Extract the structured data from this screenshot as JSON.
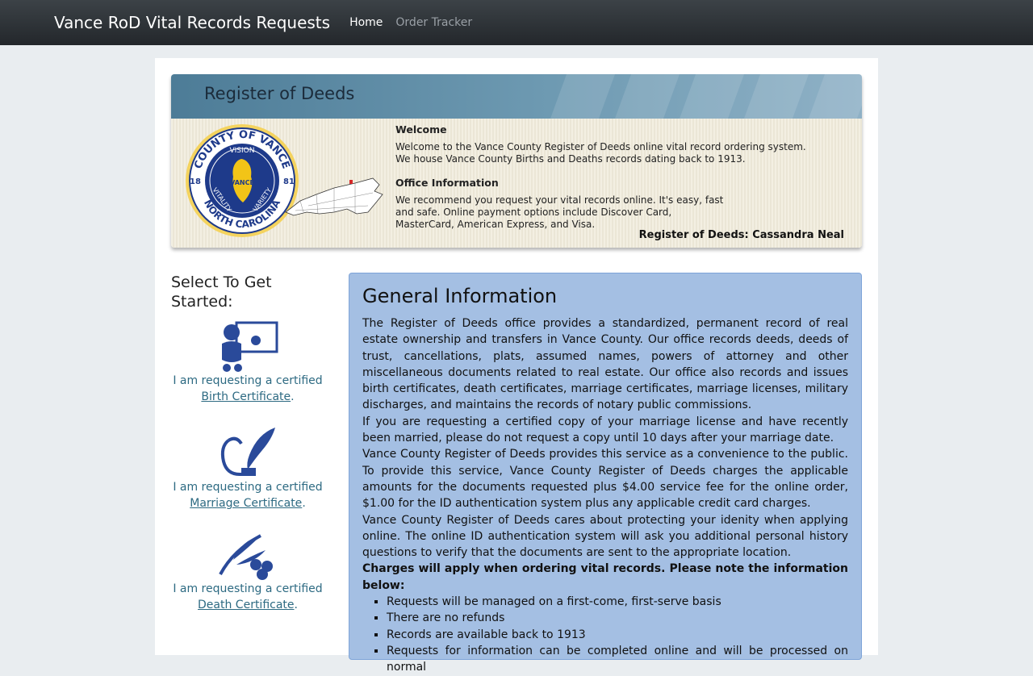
{
  "navbar": {
    "brand": "Vance RoD Vital Records Requests",
    "links": [
      {
        "label": "Home",
        "active": true
      },
      {
        "label": "Order Tracker",
        "active": false
      }
    ]
  },
  "banner": {
    "title": "Register of Deeds",
    "welcome_heading": "Welcome",
    "welcome_text_1": "Welcome to the Vance County Register of Deeds online vital record ordering system.",
    "welcome_text_2": "We house Vance County Births and Deaths records dating back to 1913.",
    "office_heading": "Office Information",
    "office_text": "We recommend you request your vital records online.  It's easy, fast and safe.  Online payment options include Discover Card, MasterCard, American Express, and Visa.",
    "register_name": "Register of Deeds: Cassandra Neal",
    "seal": {
      "top_text": "COUNTY OF VANCE",
      "bottom_text": "NORTH CAROLINA",
      "vision": "VISION",
      "vitality": "VITALITY",
      "variety": "VARIETY",
      "center": "VANCE",
      "year_left": "18",
      "year_right": "81"
    }
  },
  "sidebar": {
    "heading": "Select To Get Started:",
    "options": [
      {
        "icon": "baby-certificate-icon",
        "prefix": "I am requesting a certified",
        "link": "Birth Certificate",
        "suffix": "."
      },
      {
        "icon": "quill-scroll-icon",
        "prefix": "I am requesting a certified",
        "link": "Marriage Certificate",
        "suffix": "."
      },
      {
        "icon": "olive-branch-icon",
        "prefix": "I am requesting a certified",
        "link": "Death Certificate",
        "suffix": "."
      }
    ]
  },
  "info": {
    "title": "General Information",
    "p1": "The Register of Deeds office provides a standardized, permanent record of real estate ownership and transfers in Vance County. Our office records deeds, deeds of trust, cancellations, plats, assumed names, powers of attorney and other miscellaneous documents related to real estate. Our office also records and issues birth certificates, death certificates, marriage certificates, marriage licenses, military discharges, and maintains the records of notary public commissions.",
    "p2": "If you are requesting a certified copy of your marriage license and have recently been married, please do not request a copy until 10 days after your marriage date.",
    "p3": "Vance County Register of Deeds provides this service as a convenience to the public. To provide this service, Vance County Register of Deeds charges the applicable amounts for the documents requested plus $4.00 service fee for the online order, $1.00 for the ID authentication system plus any applicable credit card charges.",
    "p4": "Vance County Register of Deeds cares about protecting your idenity when applying online. The online ID authentication system will ask you additional personal history questions to verify that the documents are sent to the appropriate location.",
    "charges_note": "Charges will apply when ordering vital records.  Please note the information below:",
    "bullets": [
      "Requests will be managed on a first-come, first-serve basis",
      "There are no refunds",
      "Records are available back to 1913",
      "Requests for information can be completed online and will be processed on normal"
    ]
  }
}
